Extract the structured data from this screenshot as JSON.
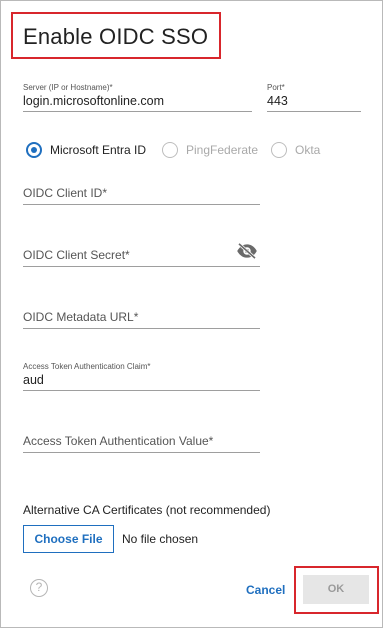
{
  "dialog": {
    "title": "Enable OIDC SSO"
  },
  "server": {
    "label": "Server (IP or Hostname)*",
    "value": "login.microsoftonline.com"
  },
  "port": {
    "label": "Port*",
    "value": "443"
  },
  "provider": {
    "options": [
      {
        "label": "Microsoft Entra ID",
        "selected": true,
        "enabled": true
      },
      {
        "label": "PingFederate",
        "selected": false,
        "enabled": false
      },
      {
        "label": "Okta",
        "selected": false,
        "enabled": false
      }
    ]
  },
  "client_id": {
    "placeholder": "OIDC Client ID*",
    "value": ""
  },
  "client_secret": {
    "placeholder": "OIDC Client Secret*",
    "value": "",
    "icon": "eye-off-icon"
  },
  "metadata_url": {
    "placeholder": "OIDC Metadata URL*",
    "value": ""
  },
  "token_claim": {
    "label": "Access Token Authentication Claim*",
    "value": "aud"
  },
  "token_value": {
    "placeholder": "Access Token Authentication Value*",
    "value": ""
  },
  "ca_certs": {
    "label": "Alternative CA Certificates (not recommended)",
    "button_label": "Choose File",
    "status": "No file chosen"
  },
  "footer": {
    "help_icon": "help-icon",
    "help_glyph": "?",
    "cancel_label": "Cancel",
    "ok_label": "OK"
  },
  "colors": {
    "accent": "#1f6fbf",
    "highlight": "#d8262c",
    "disabled_bg": "#e6e6e6"
  }
}
